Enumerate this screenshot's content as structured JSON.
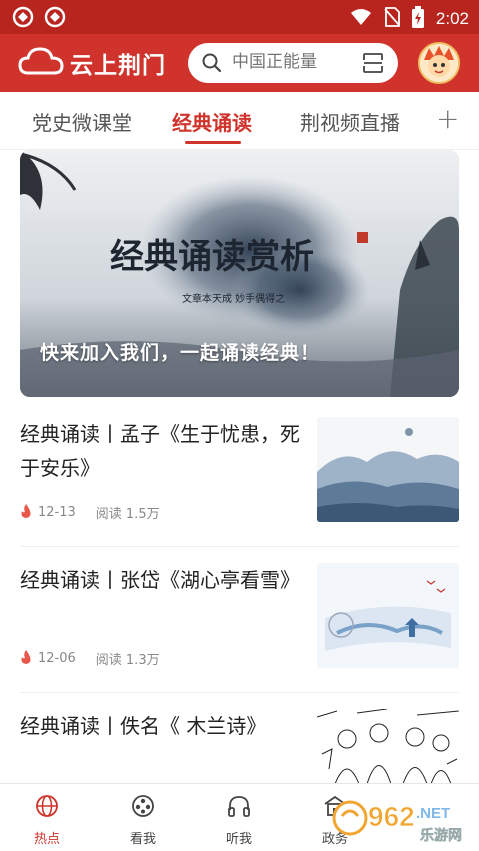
{
  "status_bar": {
    "time": "2:02"
  },
  "header": {
    "logo_text": "云上荆门",
    "search_placeholder": "中国正能量"
  },
  "tabs": [
    {
      "label": "党史微课堂",
      "active": false
    },
    {
      "label": "经典诵读",
      "active": true
    },
    {
      "label": "荆视频直播",
      "active": false
    }
  ],
  "tab_add": "+",
  "banner": {
    "caption": "快来加入我们，一起诵读经典！",
    "art_title": "经典诵读赏析",
    "art_subtitle": "文章本天成  妙手偶得之"
  },
  "articles": [
    {
      "title": "经典诵读丨孟子《生于忧患，死于安乐》",
      "date": "12-13",
      "views": "阅读 1.5万"
    },
    {
      "title": "经典诵读丨张岱《湖心亭看雪》",
      "date": "12-06",
      "views": "阅读 1.3万"
    },
    {
      "title": "经典诵读丨佚名《 木兰诗》",
      "date": "",
      "views": ""
    }
  ],
  "bottom_nav": [
    {
      "label": "热点",
      "icon": "globe-icon",
      "active": true
    },
    {
      "label": "看我",
      "icon": "film-reel-icon",
      "active": false
    },
    {
      "label": "听我",
      "icon": "headphones-icon",
      "active": false
    },
    {
      "label": "政务",
      "icon": "government-icon",
      "active": false
    }
  ],
  "watermark": {
    "number": "962",
    "suffix": ".NET",
    "text": "乐游网"
  },
  "colors": {
    "brand": "#d0332b",
    "status_bar": "#b8251e",
    "accent_text": "#d0332b"
  }
}
